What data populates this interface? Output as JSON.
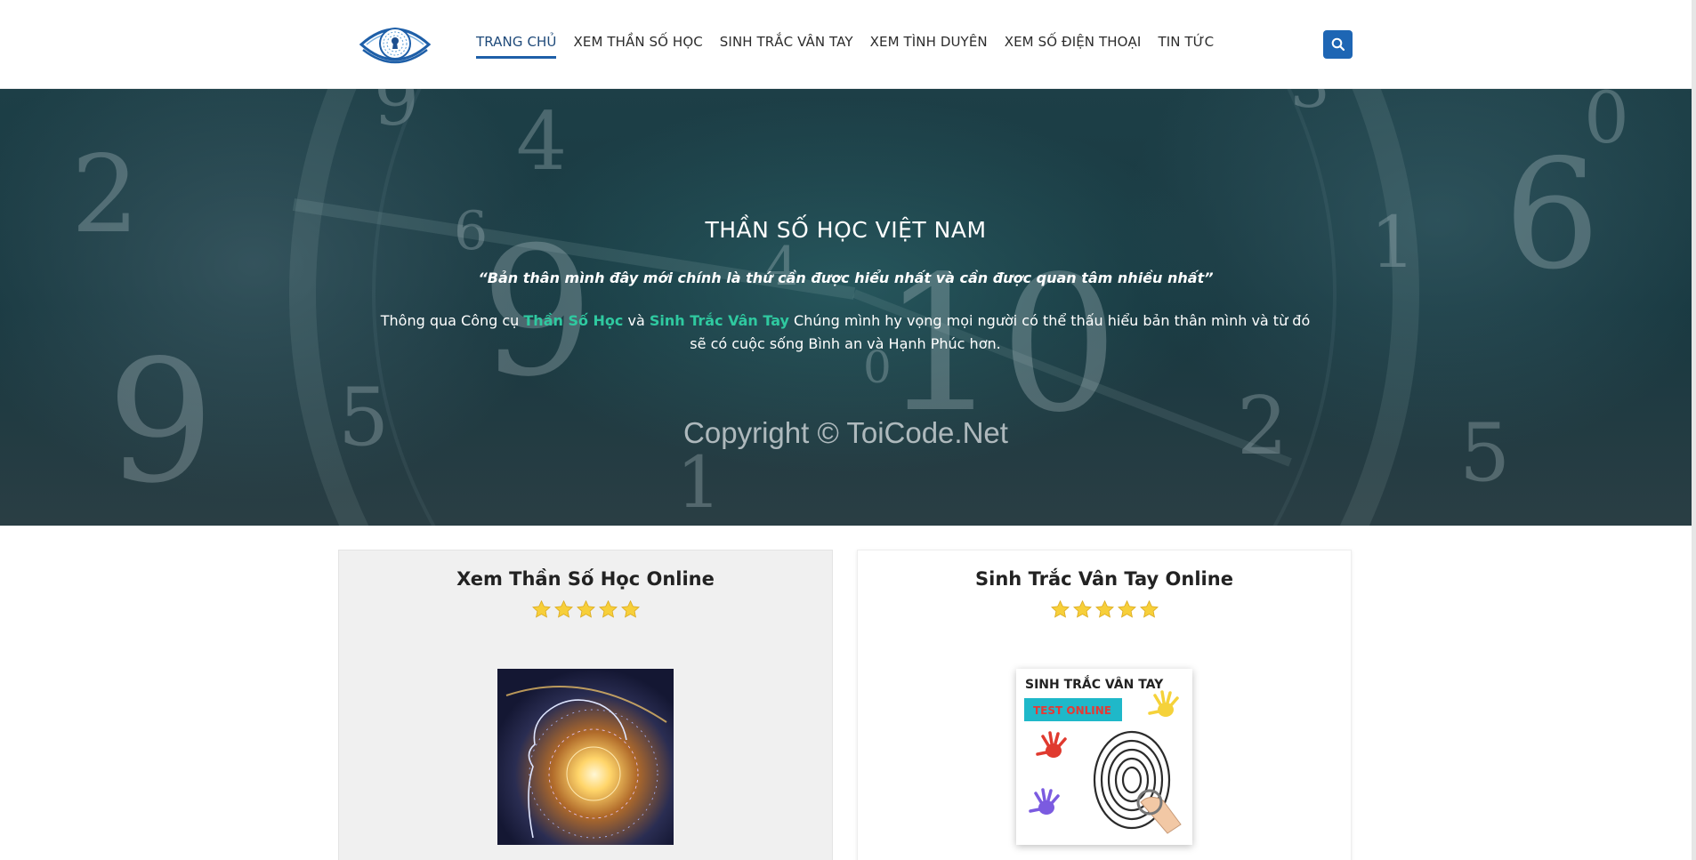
{
  "header": {
    "logo_icon": "eye-keyhole-logo",
    "nav": [
      {
        "label": "TRANG CHỦ",
        "active": true
      },
      {
        "label": "XEM THẦN SỐ HỌC",
        "active": false
      },
      {
        "label": "SINH TRẮC VÂN TAY",
        "active": false
      },
      {
        "label": "XEM TÌNH DUYÊN",
        "active": false
      },
      {
        "label": "XEM SỐ ĐIỆN THOẠI",
        "active": false
      },
      {
        "label": "TIN TỨC",
        "active": false
      }
    ],
    "search_icon": "search-icon"
  },
  "hero": {
    "title": "THẦN SỐ HỌC VIỆT NAM",
    "quote": "“Bản thân mình đây mới chính là thứ cần được hiểu nhất và cần được quan tâm nhiều nhất”",
    "desc_before": "Thông qua Công cụ ",
    "desc_link1": "Thần Số Học",
    "desc_mid": " và ",
    "desc_link2": "Sinh Trắc Vân Tay",
    "desc_after": " Chúng mình hy vọng mọi người có thể thấu hiểu bản thân mình và từ đó sẽ có cuộc sống Bình an và Hạnh Phúc hơn.",
    "watermark": "Copyright © ToiCode.Net"
  },
  "cards": [
    {
      "title": "Xem Thần Số Học Online",
      "rating": 5,
      "image": "numerology-head-spiral"
    },
    {
      "title": "Sinh Trắc Vân Tay Online",
      "rating": 5,
      "image": "fingerprint-test",
      "image_text": {
        "heading": "SINH TRẮC VÂN TAY",
        "badge": "TEST ONLINE"
      }
    }
  ],
  "colors": {
    "accent": "#1e66b4",
    "highlight": "#2fc9a0",
    "badge": "#1fb8c9",
    "badge_text": "#e53935"
  }
}
